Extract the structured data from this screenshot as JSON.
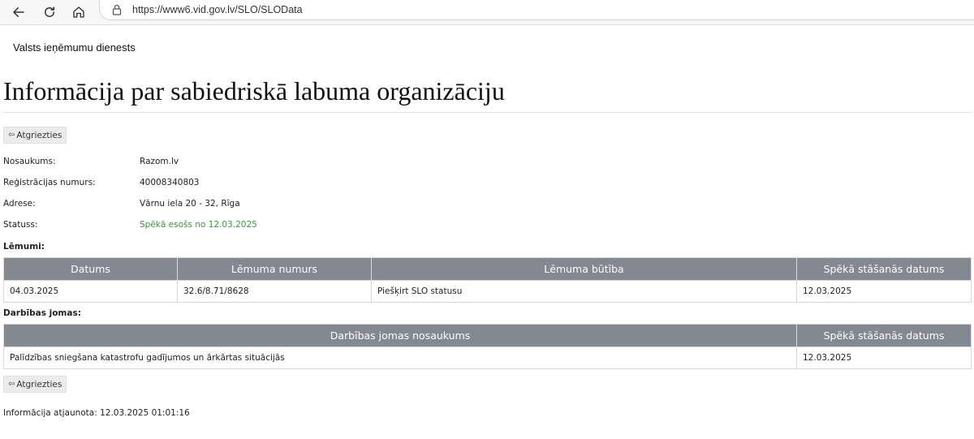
{
  "browser": {
    "url": "https://www6.vid.gov.lv/SLO/SLOData"
  },
  "page": {
    "agency": "Valsts ieņēmumu dienests",
    "title": "Informācija par sabiedriskā labuma organizāciju",
    "back_label": "Atgriezties",
    "back_icon": "left-arrow-icon"
  },
  "details": {
    "name_label": "Nosaukums:",
    "name_value": "Razom.lv",
    "reg_label": "Reģistrācijas numurs:",
    "reg_value": "40008340803",
    "address_label": "Adrese:",
    "address_value": "Vārnu iela 20 - 32, Rīga",
    "status_label": "Statuss:",
    "status_value": "Spēkā esošs no 12.03.2025",
    "status_color": "#3a9a3a"
  },
  "decisions": {
    "heading": "Lēmumi:",
    "columns": [
      "Datums",
      "Lēmuma numurs",
      "Lēmuma būtība",
      "Spēkā stāšanās datums"
    ],
    "rows": [
      [
        "04.03.2025",
        "32.6/8.71/8628",
        "Piešķirt SLO statusu",
        "12.03.2025"
      ]
    ]
  },
  "activities": {
    "heading": "Darbības jomas:",
    "columns": [
      "Darbības jomas nosaukums",
      "Spēkā stāšanās datums"
    ],
    "rows": [
      [
        "Palīdzības sniegšana katastrofu gadījumos un ārkārtas situācijās",
        "12.03.2025"
      ]
    ]
  },
  "footer": {
    "updated": "Informācija atjaunota: 12.03.2025 01:01:16"
  },
  "colors": {
    "table_header_bg": "#838891"
  }
}
